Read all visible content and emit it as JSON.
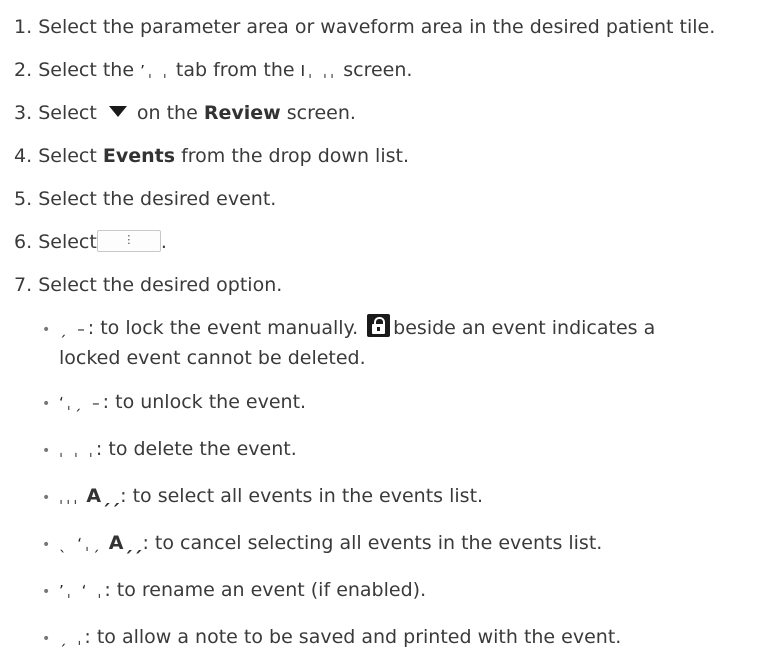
{
  "steps": [
    {
      "n": "1.",
      "parts": [
        "Select the parameter area or waveform area in the desired patient tile."
      ]
    },
    {
      "n": "2.",
      "parts": [
        "Select the",
        "tab from the",
        "screen."
      ],
      "g1": "ʼˌ ˌ",
      "g2": "Iˌ   ˌˌ"
    },
    {
      "n": "3.",
      "parts": [
        "Select",
        "on the",
        "Review",
        "screen."
      ]
    },
    {
      "n": "4.",
      "parts": [
        "Select",
        "Events",
        "from the drop down list."
      ]
    },
    {
      "n": "5.",
      "parts": [
        "Select the desired event."
      ]
    },
    {
      "n": "6.",
      "parts": [
        "Select",
        "."
      ],
      "btn": "⋮"
    },
    {
      "n": "7.",
      "parts": [
        "Select the desired option."
      ]
    }
  ],
  "options": [
    {
      "glyph": "ˏ –",
      "text": ": to lock the event manually.",
      "text2": "beside an event indicates a",
      "text3": "locked event cannot be deleted."
    },
    {
      "glyph": "ʻˌˏ –",
      "text": ": to unlock the event."
    },
    {
      "glyph": "ˌ ˌ ˌ",
      "text": ": to delete the event."
    },
    {
      "glyph": "ˌˌˌ",
      "bold": "Aˏˏ",
      "text": ": to select all events in the events list."
    },
    {
      "glyph": "ˎ ʻˌˏ",
      "bold": "Aˏˏ",
      "text": ": to cancel selecting all events in the events list."
    },
    {
      "glyph": "ʼˌ ʻ  ˌ",
      "text": ": to rename an event (if enabled)."
    },
    {
      "glyph": "ˏ ˌ",
      "text": ": to allow a note to be saved and printed with the event."
    }
  ],
  "bullet": "•"
}
